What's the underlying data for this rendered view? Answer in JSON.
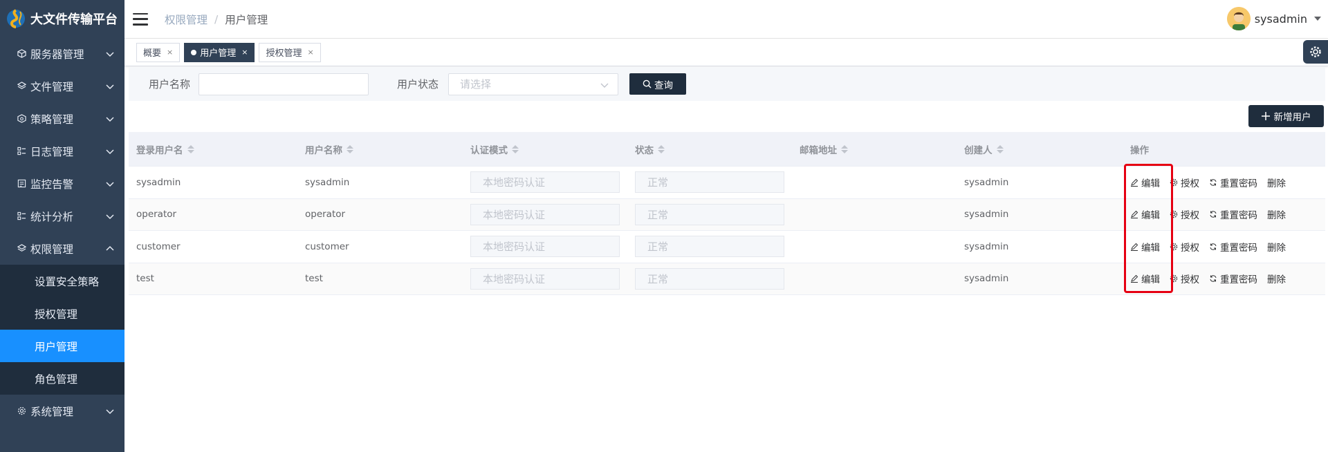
{
  "app": {
    "title": "大文件传输平台"
  },
  "sidebar": {
    "items": [
      {
        "label": "服务器管理",
        "icon": "box-icon"
      },
      {
        "label": "文件管理",
        "icon": "layers-icon"
      },
      {
        "label": "策略管理",
        "icon": "box-search-icon"
      },
      {
        "label": "日志管理",
        "icon": "list-icon"
      },
      {
        "label": "监控告警",
        "icon": "calendar-icon"
      },
      {
        "label": "统计分析",
        "icon": "list-icon"
      },
      {
        "label": "权限管理",
        "icon": "layers-icon"
      }
    ],
    "sub_items": [
      {
        "label": "设置安全策略"
      },
      {
        "label": "授权管理"
      },
      {
        "label": "用户管理"
      },
      {
        "label": "角色管理"
      }
    ],
    "last_item": {
      "label": "系统管理",
      "icon": "gear-icon"
    }
  },
  "header": {
    "breadcrumb": [
      "权限管理",
      "/",
      "用户管理"
    ],
    "user_name": "sysadmin"
  },
  "tags": [
    {
      "label": "概要",
      "close": "×"
    },
    {
      "label": "用户管理",
      "close": "×"
    },
    {
      "label": "授权管理",
      "close": "×"
    }
  ],
  "search": {
    "username_label": "用户名称",
    "username_value": "",
    "status_label": "用户状态",
    "status_placeholder": "请选择",
    "query_label": "查询"
  },
  "toolbar": {
    "add_label": "新增用户"
  },
  "table": {
    "columns": [
      "登录用户名",
      "用户名称",
      "认证模式",
      "状态",
      "邮箱地址",
      "创建人",
      "操作"
    ],
    "rows": [
      {
        "login": "sysadmin",
        "name": "sysadmin",
        "auth": "本地密码认证",
        "status": "正常",
        "email": "",
        "creator": "sysadmin"
      },
      {
        "login": "operator",
        "name": "operator",
        "auth": "本地密码认证",
        "status": "正常",
        "email": "",
        "creator": "sysadmin"
      },
      {
        "login": "customer",
        "name": "customer",
        "auth": "本地密码认证",
        "status": "正常",
        "email": "",
        "creator": "sysadmin"
      },
      {
        "login": "test",
        "name": "test",
        "auth": "本地密码认证",
        "status": "正常",
        "email": "",
        "creator": "sysadmin"
      }
    ],
    "actions": {
      "edit": "编辑",
      "grant": "授权",
      "reset": "重置密码",
      "delete": "删除"
    }
  },
  "colors": {
    "sidebar_bg": "#304156",
    "active_blue": "#1890ff",
    "dark_button": "#1f2d3d",
    "highlight_red": "#e60012"
  }
}
